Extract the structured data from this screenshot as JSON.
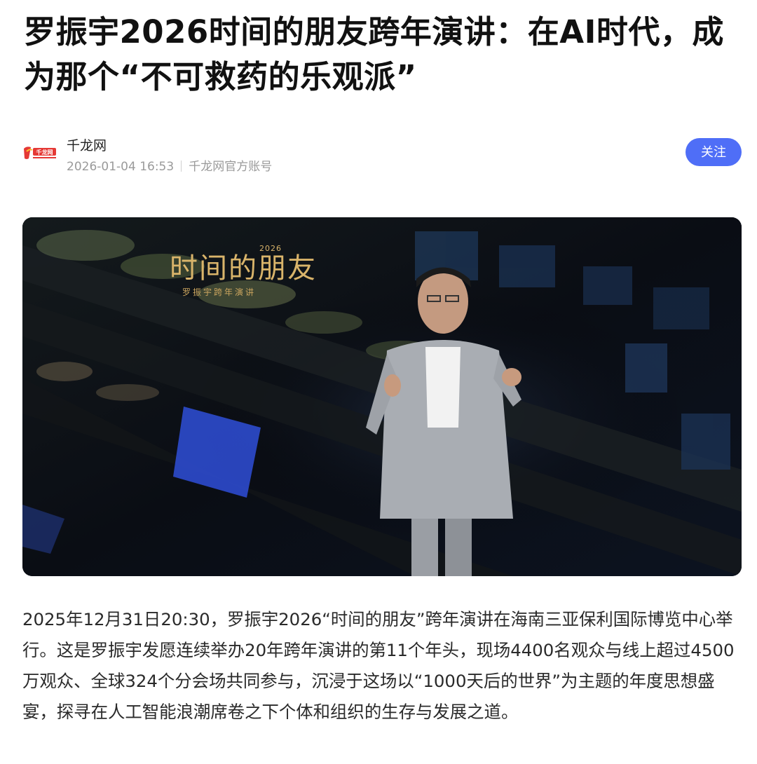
{
  "article": {
    "title": "罗振宇2026时间的朋友跨年演讲：在AI时代，成为那个“不可救药的乐观派”",
    "body": "2025年12月31日20:30，罗振宇2026“时间的朋友”跨年演讲在海南三亚保利国际博览中心举行。这是罗振宇发愿连续举办20年跨年演讲的第11个年头，现场4400名观众与线上超过4500万观众、全球324个分会场共同参与，沉浸于这场以“1000天后的世界”为主题的年度思想盛宴，探寻在人工智能浪潮席卷之下个体和组织的生存与发展之道。"
  },
  "author": {
    "logo_icon": "qianlong-logo-icon",
    "logo_text": "千龙网",
    "name": "千龙网",
    "datetime": "2026-01-04 16:53",
    "account_label": "千龙网官方账号",
    "follow_label": "关注"
  },
  "hero": {
    "brand": "时间的朋友",
    "year": "2026",
    "subtitle": "罗振宇跨年演讲"
  },
  "colors": {
    "accent": "#4f6ef7",
    "meta_gray": "#9a9a9a",
    "hero_gold": "#d9b46a"
  }
}
